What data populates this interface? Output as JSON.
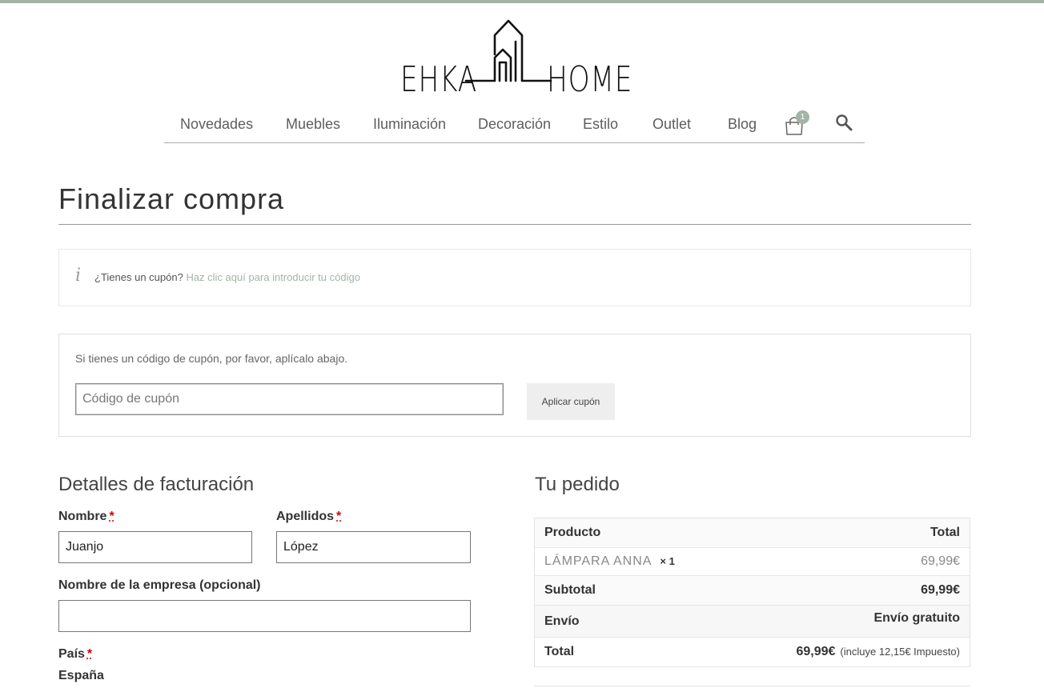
{
  "brand": {
    "left_word": "EHKA",
    "right_word": "HOME"
  },
  "nav": {
    "items": [
      "Novedades",
      "Muebles",
      "Iluminación",
      "Decoración",
      "Estilo",
      "Outlet",
      "Blog"
    ],
    "cart_count": "1"
  },
  "page": {
    "title": "Finalizar compra"
  },
  "coupon_notice": {
    "question": "¿Tienes un cupón?",
    "link": "Haz clic aquí para introducir tu código"
  },
  "coupon_form": {
    "hint": "Si tienes un código de cupón, por favor, aplícalo abajo.",
    "placeholder": "Código de cupón",
    "button": "Aplicar cupón"
  },
  "billing": {
    "title": "Detalles de facturación",
    "first_name_label": "Nombre",
    "first_name_value": "Juanjo",
    "last_name_label": "Apellidos",
    "last_name_value": "López",
    "company_label": "Nombre de la empresa (opcional)",
    "company_value": "",
    "country_label": "País",
    "country_value": "España",
    "required_mark": "*"
  },
  "order": {
    "title": "Tu pedido",
    "col_product": "Producto",
    "col_total": "Total",
    "item_name": "LÁMPARA ANNA",
    "item_qty": "× 1",
    "item_price": "69,99€",
    "subtotal_label": "Subtotal",
    "subtotal_value": "69,99€",
    "shipping_label": "Envío",
    "shipping_value": "Envío gratuito",
    "total_label": "Total",
    "total_value": "69,99€",
    "tax_note": "(incluye 12,15€ Impuesto)"
  },
  "colors": {
    "accent": "#a3b4a6"
  }
}
